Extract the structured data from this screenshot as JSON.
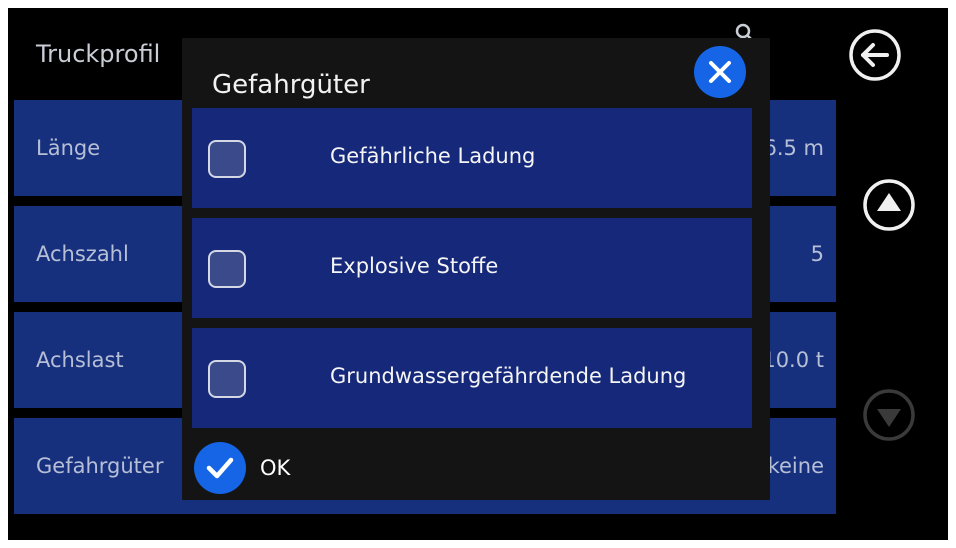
{
  "background": {
    "title": "Truckprofil",
    "rows": [
      {
        "label": "Länge",
        "value": "6.5 m"
      },
      {
        "label": "Achszahl",
        "value": "5"
      },
      {
        "label": "Achslast",
        "value": "10.0 t"
      },
      {
        "label": "Gefahrgüter",
        "value": "keine"
      }
    ]
  },
  "sidebar": {
    "back_icon": "arrow-left-circle-icon",
    "up_icon": "chevron-up-circle-icon",
    "down_icon": "chevron-down-circle-icon"
  },
  "dialog": {
    "title": "Gefahrgüter",
    "close_icon": "close-icon",
    "options": [
      {
        "label": "Gefährliche Ladung",
        "checked": false
      },
      {
        "label": "Explosive Stoffe",
        "checked": false
      },
      {
        "label": "Grundwassergefährdende Ladung",
        "checked": false
      }
    ],
    "ok_label": "OK",
    "ok_icon": "checkmark-icon"
  },
  "colors": {
    "screen_bg": "#000000",
    "row_bg": "#17307e",
    "dialog_bg": "#141414",
    "option_bg": "#15287a",
    "accent": "#1565e6"
  }
}
